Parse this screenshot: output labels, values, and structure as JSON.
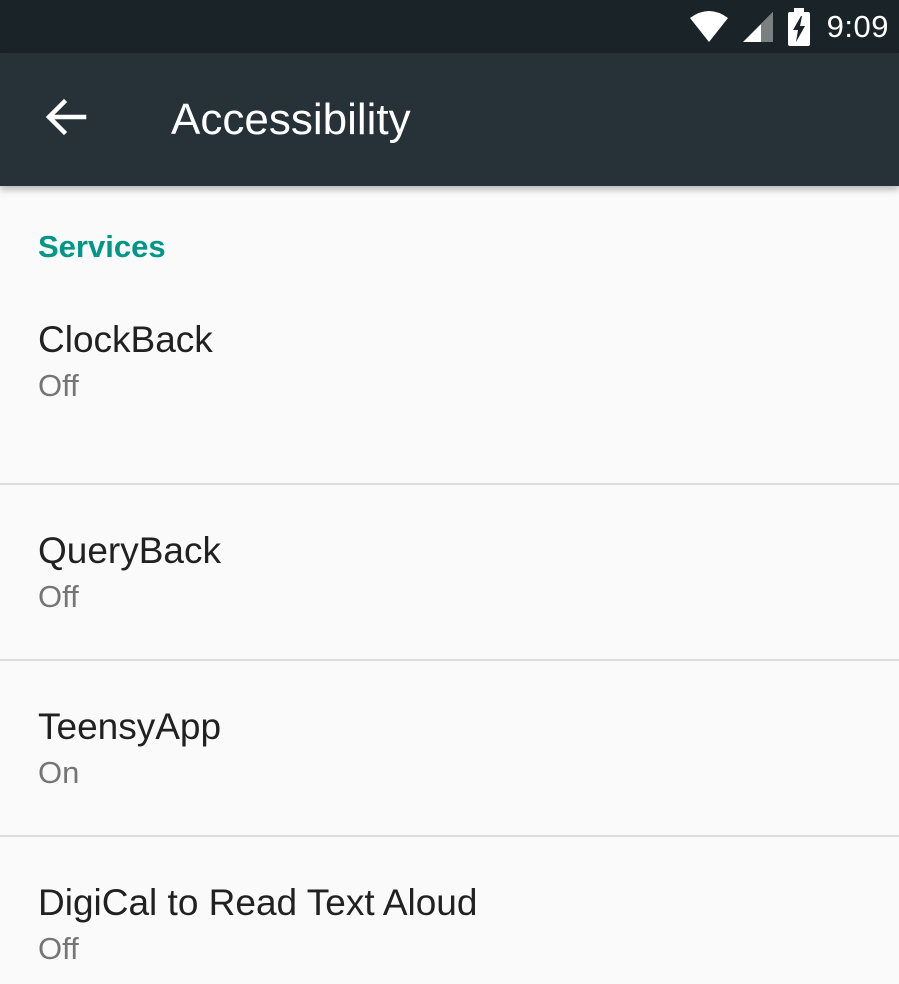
{
  "status_bar": {
    "time": "9:09",
    "icons": [
      "wifi-icon",
      "cell-signal-icon",
      "battery-charging-icon"
    ]
  },
  "app_bar": {
    "back_icon": "arrow-left-icon",
    "title": "Accessibility"
  },
  "colors": {
    "status_bar_bg": "#1a2428",
    "app_bar_bg": "#263238",
    "accent": "#009688",
    "background": "#fafafa",
    "divider": "#dedede"
  },
  "services": {
    "header": "Services",
    "items": [
      {
        "title": "ClockBack",
        "summary": "Off"
      },
      {
        "title": "QueryBack",
        "summary": "Off"
      },
      {
        "title": "TeensyApp",
        "summary": "On"
      },
      {
        "title": "DigiCal to Read Text Aloud",
        "summary": "Off"
      }
    ]
  }
}
